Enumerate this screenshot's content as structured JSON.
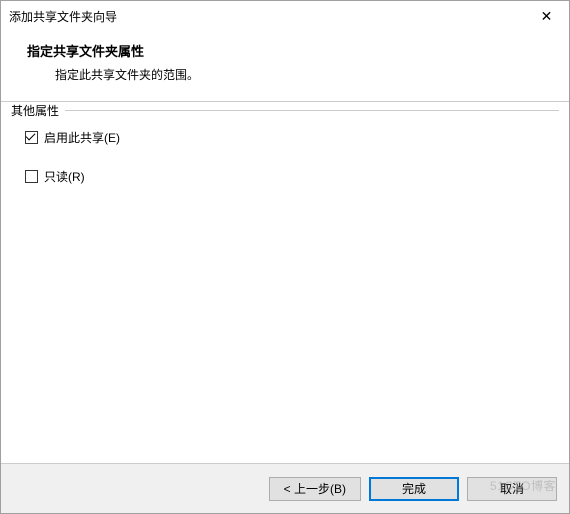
{
  "titlebar": {
    "title": "添加共享文件夹向导",
    "close_glyph": "✕"
  },
  "header": {
    "title": "指定共享文件夹属性",
    "subtitle": "指定此共享文件夹的范围。"
  },
  "fieldset": {
    "legend": "其他属性"
  },
  "checkboxes": {
    "enable_share": {
      "label": "启用此共享(E)",
      "checked": true
    },
    "read_only": {
      "label": "只读(R)",
      "checked": false
    }
  },
  "footer": {
    "back": "< 上一步(B)",
    "finish": "完成",
    "cancel": "取消"
  },
  "watermark": "51CTO博客"
}
